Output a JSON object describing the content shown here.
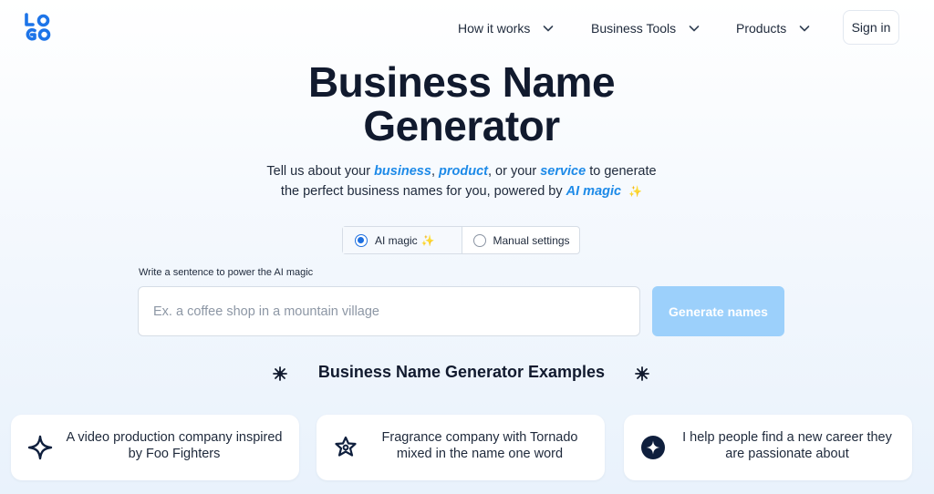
{
  "header": {
    "logo_icon": "logo-icon",
    "logo_text": "LOGO",
    "nav": [
      {
        "label": "How it works",
        "icon": "chevron-down-icon"
      },
      {
        "label": "Business Tools",
        "icon": "chevron-down-icon"
      },
      {
        "label": "Products",
        "icon": "chevron-down-icon"
      }
    ],
    "signin_label": "Sign in"
  },
  "hero": {
    "title_line1": "Business Name",
    "title_line2": "Generator",
    "subtitle": {
      "p1": "Tell us about your ",
      "h1": "business",
      "p2": ", ",
      "h2": "product",
      "p3": ", or your ",
      "h3": "service",
      "p4": " to generate",
      "p5": "the perfect business names for you, powered by ",
      "h4": "AI magic",
      "sparkle": "✨"
    }
  },
  "mode_toggle": {
    "options": [
      {
        "label": "AI magic",
        "sparkle": "✨",
        "selected": true
      },
      {
        "label": "Manual settings",
        "selected": false
      }
    ]
  },
  "form": {
    "label": "Write a sentence to power the AI magic",
    "placeholder": "Ex. a coffee shop in a mountain village",
    "value": "",
    "button_label": "Generate names"
  },
  "examples": {
    "title": "Business Name Generator Examples",
    "cards": [
      {
        "text": "A video production company inspired by Foo Fighters",
        "icon": "sparkle-outline-icon"
      },
      {
        "text": "Fragrance company with Tornado mixed in the name one word",
        "icon": "flower-star-icon"
      },
      {
        "text": "I help people find a new career they are passionate about",
        "icon": "star-circle-icon"
      }
    ]
  },
  "colors": {
    "accent": "#1d8ae8",
    "button_disabled": "#9cd0fb",
    "logo": "#1d74e8",
    "title": "#111a2e"
  }
}
